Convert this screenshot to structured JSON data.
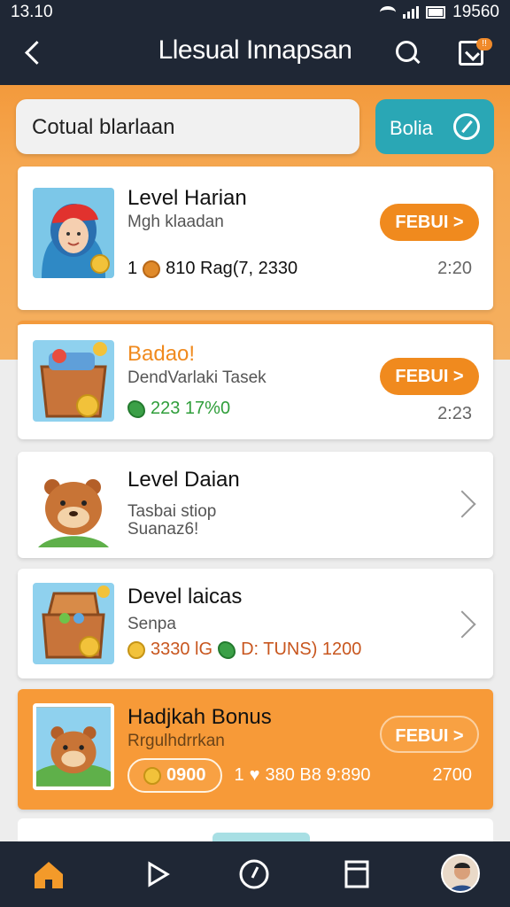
{
  "status": {
    "time": "13.10",
    "right": "19560"
  },
  "appbar": {
    "title": "Llesual Innapsan"
  },
  "search": {
    "value": "Cotual blarlaan",
    "button_label": "Bolia"
  },
  "cards": [
    {
      "title": "Level Harian",
      "subtitle": "Mgh klaadan",
      "meta_count": "1",
      "meta_text": "810 Rag(7, 2330",
      "time": "2:20",
      "button": "FEBUI >"
    },
    {
      "title": "Badao!",
      "subtitle": "DendVarlaki Tasek",
      "meta_text": "223 17%0",
      "time": "2:23",
      "button": "FEBUI >"
    },
    {
      "title": "Level Daian",
      "subtitle_line1": "Tasbai stiop",
      "subtitle_line2": "Suanaz6!"
    },
    {
      "title": "Devel laicas",
      "subtitle": "Senpa",
      "meta_text": "3330 lG",
      "meta_text2": "D: TUNS) 1200"
    },
    {
      "title": "Hadjkah Bonus",
      "subtitle": "Rrgulhdrrkan",
      "badge": "0900",
      "meta_count": "1",
      "meta_text": "380 B8 9:890",
      "time": "2700",
      "button": "FEBUI >"
    }
  ],
  "nav": {
    "items": [
      "home-icon",
      "play-icon",
      "compass-icon",
      "document-icon",
      "profile-avatar"
    ]
  },
  "colors": {
    "primary_dark": "#1f2735",
    "accent_orange": "#f08a1e",
    "teal": "#2aa7b5"
  }
}
